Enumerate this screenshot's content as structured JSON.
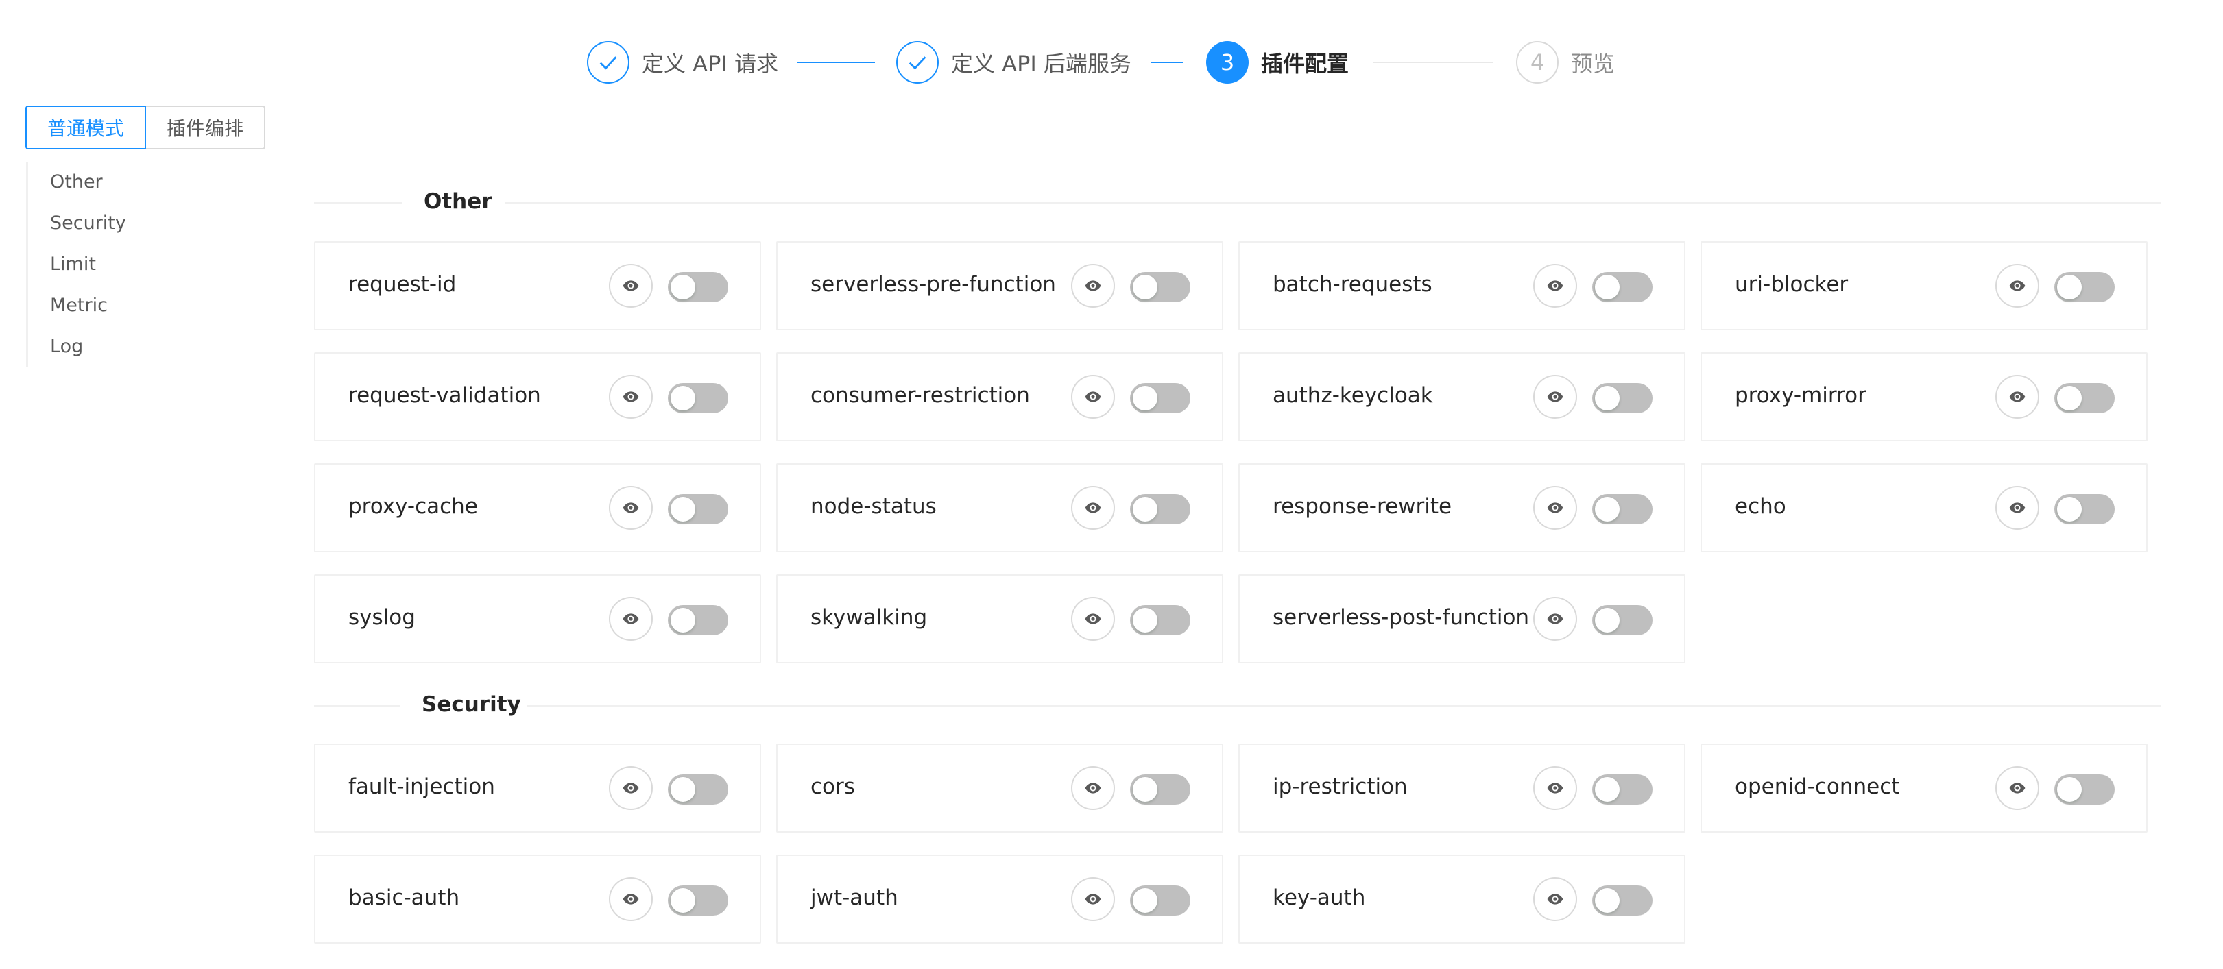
{
  "steps": [
    {
      "title": "定义 API 请求",
      "status": "finished",
      "icon": "check-icon"
    },
    {
      "title": "定义 API 后端服务",
      "status": "finished",
      "icon": "check-icon"
    },
    {
      "title": "插件配置",
      "status": "process",
      "number": "3"
    },
    {
      "title": "预览",
      "status": "wait",
      "number": "4"
    }
  ],
  "mode": {
    "normal_label": "普通模式",
    "orchestration_label": "插件编排",
    "selected": "普通模式"
  },
  "anchor": {
    "items": [
      "Other",
      "Security",
      "Limit",
      "Metric",
      "Log"
    ]
  },
  "sections": [
    {
      "title": "Other",
      "plugins": [
        "request-id",
        "serverless-pre-function",
        "batch-requests",
        "uri-blocker",
        "request-validation",
        "consumer-restriction",
        "authz-keycloak",
        "proxy-mirror",
        "proxy-cache",
        "node-status",
        "response-rewrite",
        "echo",
        "syslog",
        "skywalking",
        "serverless-post-function"
      ]
    },
    {
      "title": "Security",
      "plugins": [
        "fault-injection",
        "cors",
        "ip-restriction",
        "openid-connect",
        "basic-auth",
        "jwt-auth",
        "key-auth"
      ]
    }
  ],
  "colors": {
    "primary": "#1890ff",
    "switch_off": "#bfbfbf",
    "border": "#f0f0f0"
  }
}
